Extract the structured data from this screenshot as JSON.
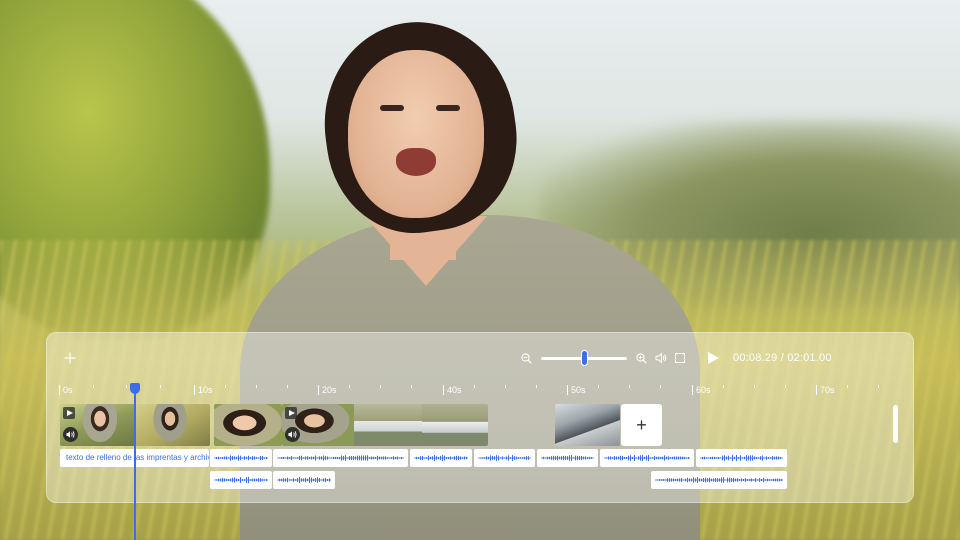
{
  "toolbar": {
    "add_icon": "plus-icon",
    "zoom_out_icon": "zoom-out-icon",
    "zoom_in_icon": "zoom-in-icon",
    "zoom_level": 0.5,
    "volume_icon": "volume-icon",
    "fullscreen_icon": "fullscreen-icon",
    "play_icon": "play-icon",
    "current_time": "00:08.29",
    "separator": "/",
    "total_time": "02:01.00"
  },
  "ruler": {
    "labels": [
      "0s",
      "10s",
      "20s",
      "40s",
      "50s",
      "60s",
      "70s"
    ]
  },
  "timeline": {
    "add_clip_label": "+",
    "text_clip_label": "texto de relleno de las imprentas y archivos de texto"
  },
  "colors": {
    "accent": "#3b6ee8",
    "panel_bg": "rgba(255,255,255,0.38)"
  }
}
